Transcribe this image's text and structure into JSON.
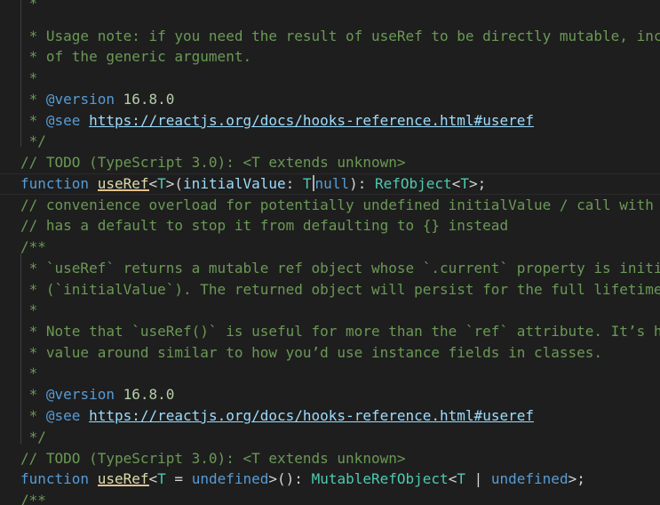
{
  "lines": [
    {
      "text": " *"
    },
    {
      "text": " * Usage note: if you need the result of useRef to be directly mutable, inc"
    },
    {
      "text": " * of the generic argument."
    },
    {
      "text": " *"
    },
    {
      "tag": "@version",
      "value": "16.8.0",
      "prefix": " * "
    },
    {
      "tag": "@see",
      "prefix": " * ",
      "link": "https://reactjs.org/docs/hooks-reference.html#useref"
    },
    {
      "text": " */"
    },
    {
      "text": "// TODO (TypeScript 3.0): <T extends unknown>"
    },
    {
      "keyword": "function",
      "name": "useRef",
      "sig_a": "<",
      "tparam": "T",
      "sig_b": ">(",
      "param": "initialValue",
      "sig_c": ": ",
      "type_t": "T",
      "pipe_hidden": "|",
      "kw_null": "null",
      "sig_d": "): ",
      "ret": "RefObject",
      "sig_e": "<",
      "ret_t": "T",
      "sig_f": ">;"
    },
    {
      "text": "// convenience overload for potentially undefined initialValue / call with"
    },
    {
      "text": "// has a default to stop it from defaulting to {} instead"
    },
    {
      "text": "/**"
    },
    {
      "text": " * `useRef` returns a mutable ref object whose `.current` property is initi"
    },
    {
      "text": " * (`initialValue`). The returned object will persist for the full lifetime"
    },
    {
      "text": " *"
    },
    {
      "text": " * Note that `useRef()` is useful for more than the `ref` attribute. It’s h"
    },
    {
      "text": " * value around similar to how you’d use instance fields in classes."
    },
    {
      "text": " *"
    },
    {
      "tag": "@version",
      "value": "16.8.0",
      "prefix": " * "
    },
    {
      "tag": "@see",
      "prefix": " * ",
      "link": "https://reactjs.org/docs/hooks-reference.html#useref"
    },
    {
      "text": " */"
    },
    {
      "text": "// TODO (TypeScript 3.0): <T extends unknown>"
    },
    {
      "keyword": "function",
      "name": "useRef",
      "sig_a": "<",
      "tparam": "T",
      "sig_b": " = ",
      "kw_undef": "undefined",
      "sig_c": ">(): ",
      "ret": "MutableRefObject",
      "sig_d": "<",
      "ret_t": "T",
      "sig_e": " | ",
      "kw_undef2": "undefined",
      "sig_f": ">;"
    },
    {
      "text": "/**"
    }
  ]
}
